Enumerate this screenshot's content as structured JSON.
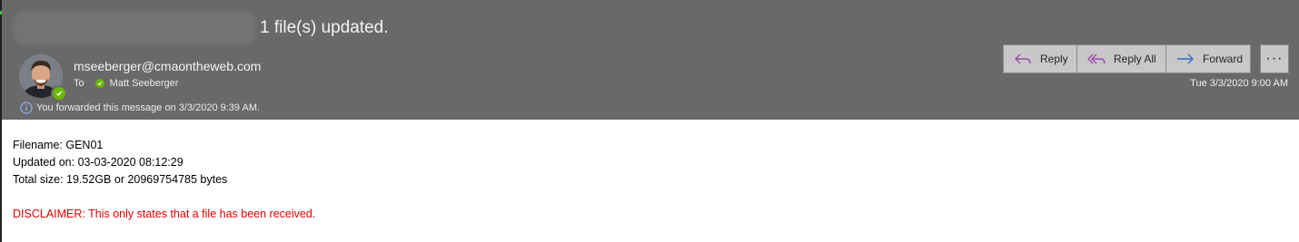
{
  "message": {
    "subject": "1 file(s) updated.",
    "sender": "mseeberger@cmaontheweb.com",
    "to_label": "To",
    "recipient": "Matt Seeberger",
    "forward_info": "You forwarded this message on 3/3/2020 9:39 AM.",
    "date": "Tue 3/3/2020 9:00 AM"
  },
  "actions": {
    "reply": "Reply",
    "reply_all": "Reply All",
    "forward": "Forward",
    "more": "···"
  },
  "body": {
    "filename": "Filename: GEN01",
    "updated": "Updated on: 03-03-2020 08:12:29",
    "size": "Total size: 19.52GB or 20969754785 bytes",
    "disclaimer": "DISCLAIMER: This only states that a file has been received."
  },
  "colors": {
    "header_bg": "#696969",
    "presence": "#6bb700",
    "disclaimer": "#e00000",
    "reply_icon": "#9b4ca8",
    "forward_icon": "#2f6fc8"
  }
}
